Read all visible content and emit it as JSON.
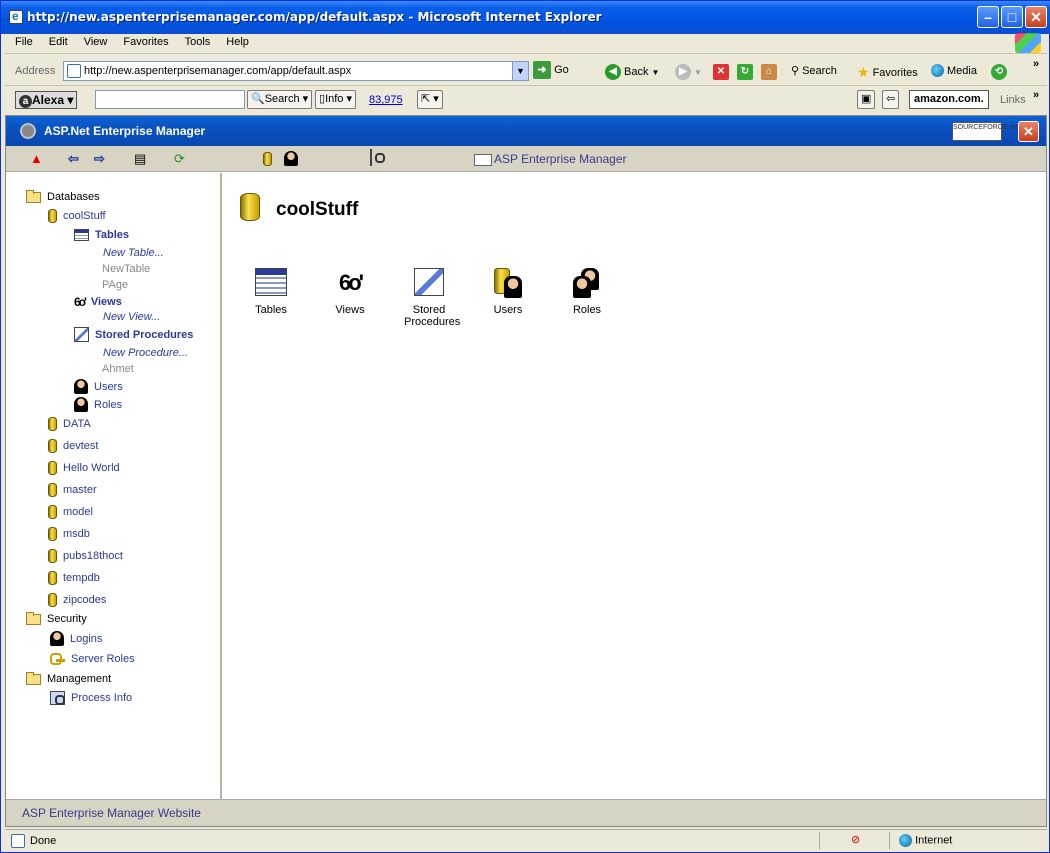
{
  "window": {
    "title": "http://new.aspenterprisemanager.com/app/default.aspx - Microsoft Internet Explorer"
  },
  "menu": [
    "File",
    "Edit",
    "View",
    "Favorites",
    "Tools",
    "Help"
  ],
  "address": {
    "label": "Address",
    "url": "http://new.aspenterprisemanager.com/app/default.aspx",
    "go": "Go"
  },
  "ie_toolbar": {
    "back": "Back",
    "search": "Search",
    "favorites": "Favorites",
    "media": "Media"
  },
  "links_bar": {
    "alexa": "Alexa",
    "search": "Search",
    "info": "Info",
    "count": "83,975",
    "amazon": "amazon.com.",
    "links": "Links"
  },
  "app": {
    "title": "ASP.Net Enterprise Manager",
    "sf_logo": "SOURCEFORGE.net",
    "brand": "ASP Enterprise Manager",
    "footer": "ASP Enterprise Manager Website"
  },
  "tree": {
    "databases": "Databases",
    "current_db": "coolStuff",
    "tables": "Tables",
    "new_table": "New Table...",
    "table_items": [
      "NewTable",
      "PAge"
    ],
    "views": "Views",
    "new_view": "New View...",
    "stored_procedures": "Stored Procedures",
    "new_procedure": "New Procedure...",
    "procedure_items": [
      "Ahmet"
    ],
    "users": "Users",
    "roles": "Roles",
    "other_dbs": [
      "DATA",
      "devtest",
      "Hello World",
      "master",
      "model",
      "msdb",
      "pubs18thoct",
      "tempdb",
      "zipcodes"
    ],
    "security": "Security",
    "logins": "Logins",
    "server_roles": "Server Roles",
    "management": "Management",
    "process_info": "Process Info"
  },
  "main": {
    "title": "coolStuff",
    "items": [
      {
        "label": "Tables",
        "icon": "table-icon"
      },
      {
        "label": "Views",
        "icon": "glasses-icon"
      },
      {
        "label": "Stored Procedures",
        "icon": "stored-procedure-icon"
      },
      {
        "label": "Users",
        "icon": "users-icon"
      },
      {
        "label": "Roles",
        "icon": "roles-icon"
      }
    ]
  },
  "status": {
    "text": "Done",
    "zone": "Internet"
  }
}
